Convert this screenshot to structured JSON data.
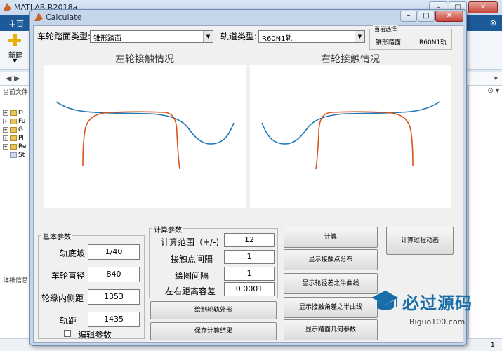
{
  "background": {
    "title": "MATLAB R2018a",
    "ribbon_tab": "主页",
    "ribbon_right": "⊗",
    "new_label": "新建",
    "current_folder": "当前文件",
    "folders": [
      "D",
      "Fu",
      "G",
      "Pl",
      "Re",
      "St"
    ],
    "details": "详细信息",
    "right_glyphs": "⊙ ▾",
    "status_page": "1"
  },
  "window": {
    "title": "Calculate"
  },
  "top": {
    "wheel_profile_label": "车轮踏面类型:",
    "wheel_profile_value": "锥形踏面",
    "rail_label": "轨道类型:",
    "rail_value": "R60N1轨",
    "current_title": "当前选择",
    "current_wheel": "锥形踏面",
    "current_rail": "R60N1轨"
  },
  "plots": {
    "left_title": "左轮接触情况",
    "right_title": "右轮接触情况"
  },
  "basic": {
    "title": "基本参数",
    "rail_cant_label": "轨底坡",
    "rail_cant_value": "1/40",
    "wheel_diameter_label": "车轮直径",
    "wheel_diameter_value": "840",
    "back_to_back_label": "轮缘内侧距",
    "back_to_back_value": "1353",
    "gauge_label": "轨距",
    "gauge_value": "1435",
    "edit_label": "编辑参数"
  },
  "calc": {
    "title": "计算参数",
    "range_label": "计算范围（+/-)",
    "range_value": "12",
    "contact_step_label": "接触点间隔",
    "contact_step_value": "1",
    "plot_step_label": "绘图间隔",
    "plot_step_value": "1",
    "tolerance_label": "左右距离容差",
    "tolerance_value": "0.0001"
  },
  "buttons": {
    "draw_profile": "绘制轮轨外形",
    "save_results": "保存计算结果",
    "calculate": "计算",
    "animation": "计算过程动画",
    "contact_dist": "显示接触点分布",
    "radius_diff": "显示轮径差之半曲线",
    "angle_diff": "显示接触角差之半曲线",
    "geometry": "显示踏面几何参数"
  },
  "watermark": {
    "big": "必过源码",
    "small": "Biguo100.com"
  },
  "colors": {
    "rail": "#1f77b4",
    "wheel": "#d95319",
    "watermark": "#1a6ea8"
  }
}
